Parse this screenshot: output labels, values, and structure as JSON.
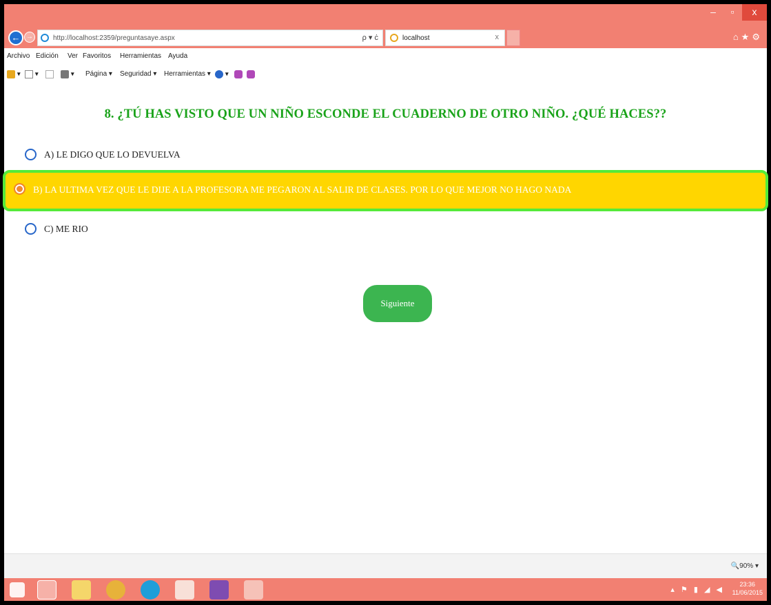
{
  "window": {
    "min_label": "–",
    "max_label": "▫",
    "close_label": "x"
  },
  "browser": {
    "back_label": "←",
    "forward_label": "→",
    "url": "http://localhost:2359/preguntasaye.aspx",
    "address_tools": "ρ ▾ ċ",
    "tab_title": "localhost",
    "tab_close": "x",
    "right_icons": "⌂★⚙"
  },
  "menubar": {
    "items": [
      "Archivo",
      "Edición",
      "Ver",
      "Favoritos",
      "Herramientas",
      "Ayuda"
    ]
  },
  "cmdbar": {
    "items": [
      "Página ▾",
      "Seguridad ▾",
      "Herramientas ▾"
    ]
  },
  "question": {
    "title": "8. ¿TÚ HAS VISTO QUE UN NIÑO ESCONDE EL CUADERNO DE OTRO NIÑO. ¿QUÉ HACES??",
    "options": [
      {
        "label": "A) LE DIGO QUE LO DEVUELVA",
        "selected": false
      },
      {
        "label": "B) LA ULTIMA VEZ QUE LE DIJE A LA PROFESORA ME PEGARON AL SALIR DE CLASES. POR LO QUE MEJOR NO HAGO NADA",
        "selected": true
      },
      {
        "label": "C) ME RIO",
        "selected": false
      }
    ],
    "next_label": "Siguiente"
  },
  "status": {
    "zoom": "🔍90%  ▾"
  },
  "taskbar": {
    "tray": "▴ ⚑ ▮ ◢ ◀",
    "time": "23:36",
    "date": "11/06/2015"
  },
  "colors": {
    "accent_green": "#1aa31a",
    "selected_bg": "#ffd600",
    "selected_border": "#55ea3a",
    "button_green": "#3cb550",
    "titlebar": "#f28072"
  }
}
